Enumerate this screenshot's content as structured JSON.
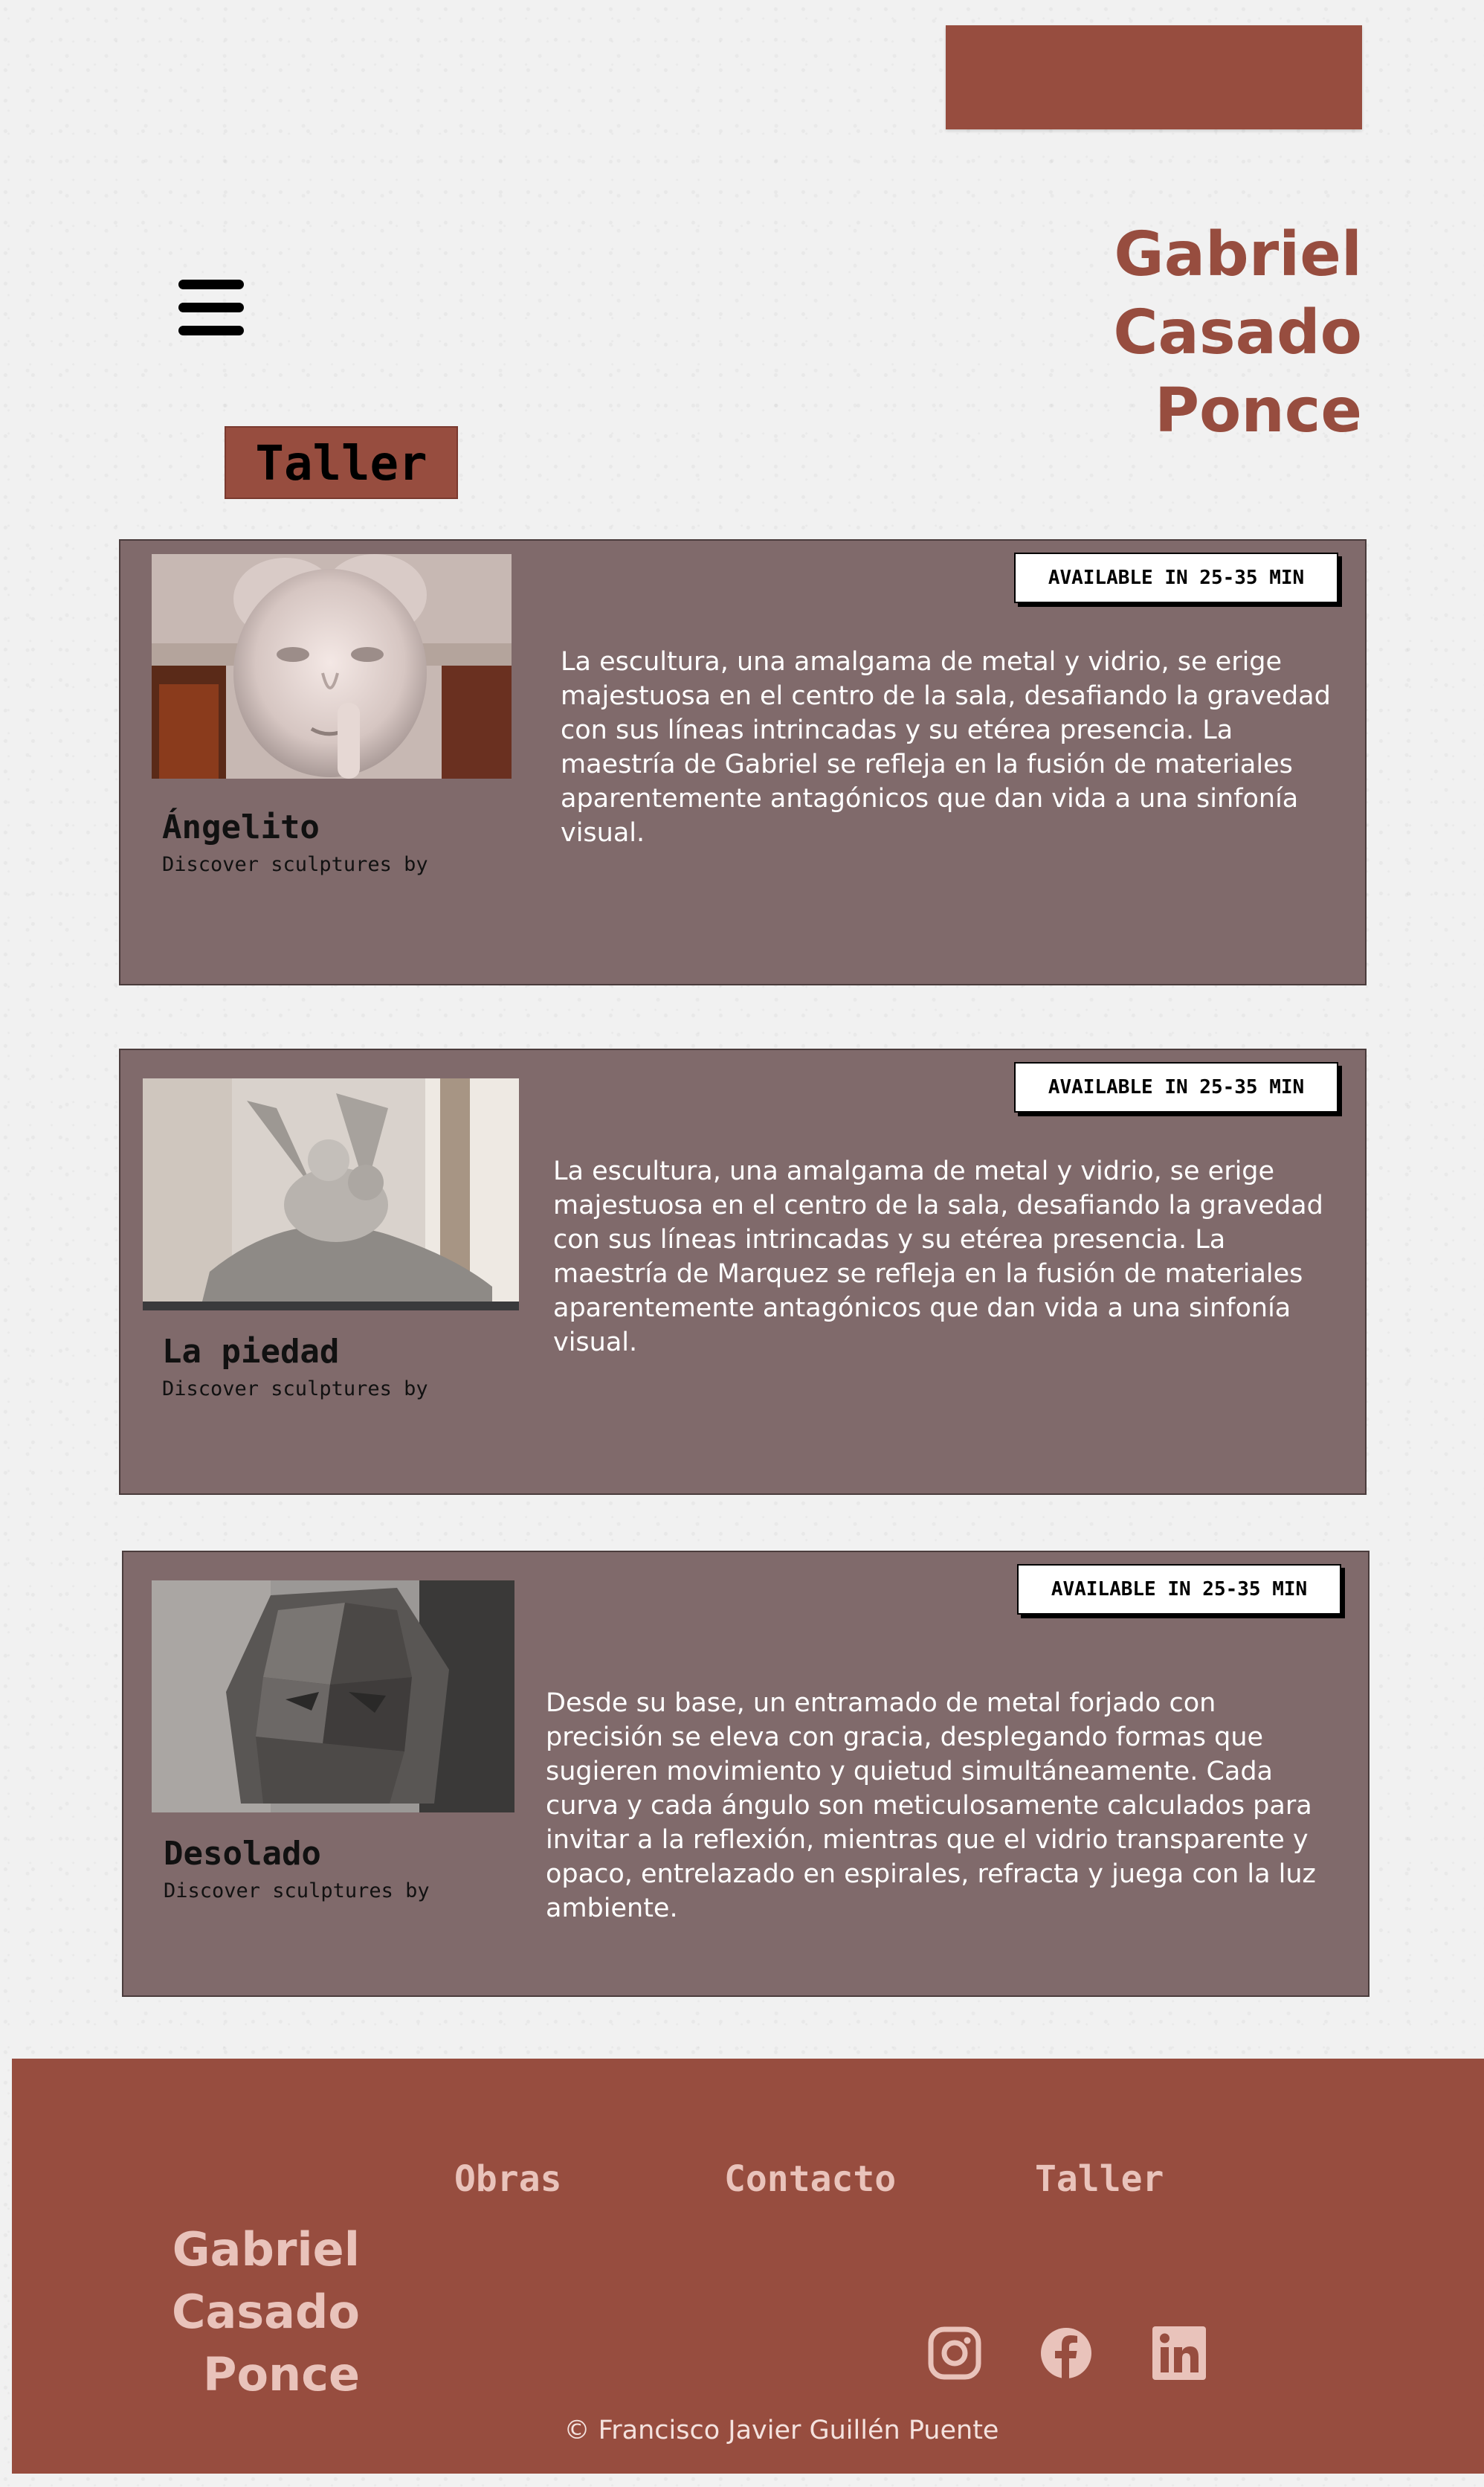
{
  "colors": {
    "brand": "#974d3f",
    "card_bg": "#806a6b",
    "footer_text": "#e9c3bb",
    "page_bg": "#f1f1f1"
  },
  "header": {
    "menu_icon": "hamburger-menu-icon",
    "brand_lines": [
      "Gabriel",
      "Casado",
      "Ponce"
    ]
  },
  "section": {
    "title": "Taller"
  },
  "cards": [
    {
      "title": "Ángelito",
      "subtitle": "Discover sculptures by",
      "badge": "AVAILABLE IN 25-35 MIN",
      "image": "cherub-sculpture-photo",
      "description": "La escultura, una amalgama de metal y vidrio, se erige majestuosa en el centro de la sala, desafiando la gravedad con sus líneas intrincadas y su etérea presencia. La maestría de Gabriel se refleja en la fusión de materiales aparentemente antagónicos que dan vida a una sinfonía visual."
    },
    {
      "title": "La piedad",
      "subtitle": "Discover sculptures by",
      "badge": "AVAILABLE IN 25-35 MIN",
      "image": "psyche-and-cupid-sculpture-photo",
      "description": "La escultura, una amalgama de metal y vidrio, se erige majestuosa en el centro de la sala, desafiando la gravedad con sus líneas intrincadas y su etérea presencia. La maestría de Marquez se refleja en la fusión de materiales aparentemente antagónicos que dan vida a una sinfonía visual."
    },
    {
      "title": "Desolado",
      "subtitle": "Discover sculptures by",
      "badge": "AVAILABLE IN 25-35 MIN",
      "image": "faceted-head-sculpture-photo",
      "description": "Desde su base, un entramado de metal forjado con precisión se eleva con gracia, desplegando formas que sugieren movimiento y quietud simultáneamente. Cada curva y cada ángulo son meticulosamente calculados para invitar a la reflexión, mientras que el vidrio transparente y opaco, entrelazado en espirales, refracta y juega con la luz ambiente."
    }
  ],
  "footer": {
    "brand_lines": [
      "Gabriel",
      "Casado",
      "Ponce"
    ],
    "nav": [
      "Obras",
      "Contacto",
      "Taller"
    ],
    "social_icons": [
      "instagram-icon",
      "facebook-icon",
      "linkedin-icon"
    ],
    "copyright": "© Francisco Javier Guillén Puente"
  }
}
